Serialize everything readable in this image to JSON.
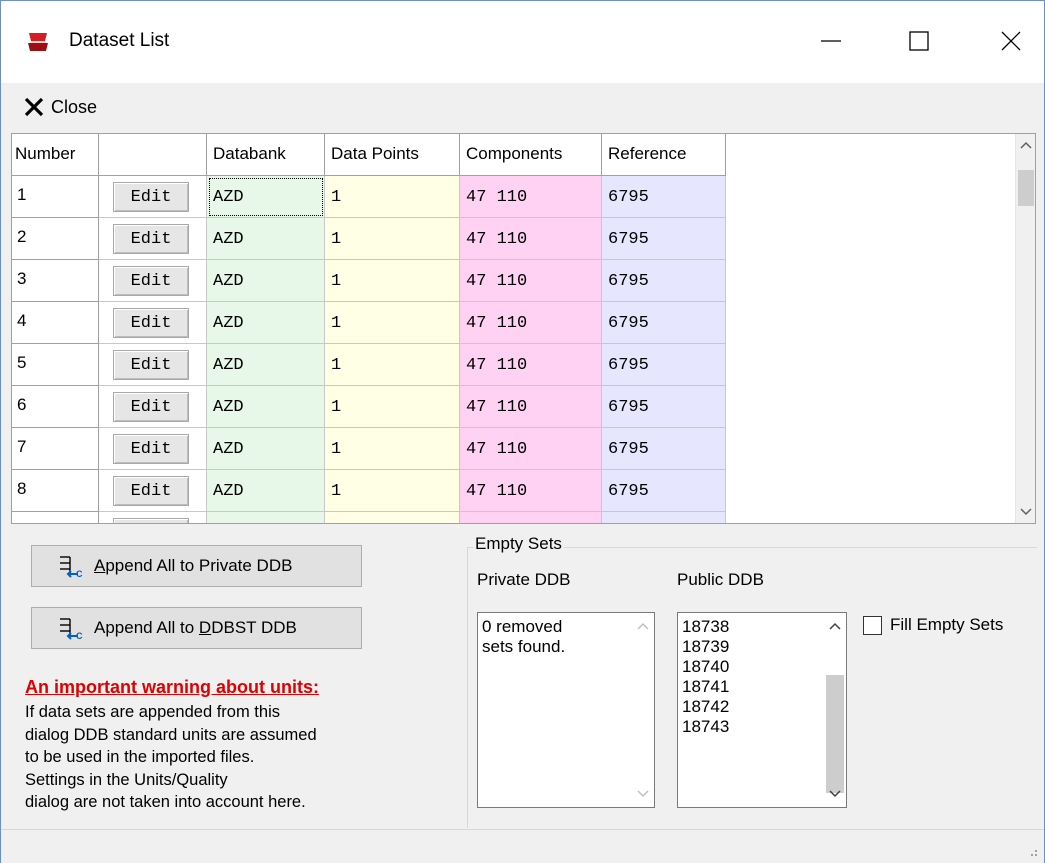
{
  "window": {
    "title": "Dataset List",
    "controls": {
      "minimize": "—",
      "maximize": "☐",
      "close": "✕"
    }
  },
  "toolbar": {
    "close_label": "Close"
  },
  "grid": {
    "columns": [
      "Number",
      "",
      "Databank",
      "Data Points",
      "Components",
      "Reference"
    ],
    "edit_label": "Edit",
    "rows": [
      {
        "number": "1",
        "databank": "AZD",
        "data_points": "1",
        "components": "47 110",
        "reference": "6795"
      },
      {
        "number": "2",
        "databank": "AZD",
        "data_points": "1",
        "components": "47 110",
        "reference": "6795"
      },
      {
        "number": "3",
        "databank": "AZD",
        "data_points": "1",
        "components": "47 110",
        "reference": "6795"
      },
      {
        "number": "4",
        "databank": "AZD",
        "data_points": "1",
        "components": "47 110",
        "reference": "6795"
      },
      {
        "number": "5",
        "databank": "AZD",
        "data_points": "1",
        "components": "47 110",
        "reference": "6795"
      },
      {
        "number": "6",
        "databank": "AZD",
        "data_points": "1",
        "components": "47 110",
        "reference": "6795"
      },
      {
        "number": "7",
        "databank": "AZD",
        "data_points": "1",
        "components": "47 110",
        "reference": "6795"
      },
      {
        "number": "8",
        "databank": "AZD",
        "data_points": "1",
        "components": "47 110",
        "reference": "6795"
      }
    ],
    "colors": {
      "databank": "#e8f8e8",
      "data_points": "#ffffe6",
      "components": "#ffd2f4",
      "reference": "#e6e6ff"
    }
  },
  "actions": {
    "append_private_prefix": "",
    "append_private_underlined": "A",
    "append_private_rest": "ppend All to Private DDB",
    "append_ddbst_prefix": "Append All to ",
    "append_ddbst_underlined": "D",
    "append_ddbst_rest": "DBST DDB"
  },
  "warning": {
    "title": "An important warning about units:",
    "lines": [
      "If data sets are appended from this",
      "dialog DDB standard units are assumed",
      "to be used in the imported files.",
      "Settings in the Units/Quality",
      "dialog are not taken into account here."
    ],
    "title_color": "#e00000"
  },
  "empty_sets": {
    "legend": "Empty Sets",
    "private_label": "Private DDB",
    "private_lines": [
      "0 removed",
      "sets found."
    ],
    "public_label": "Public DDB",
    "public_items": [
      "18738",
      "18739",
      "18740",
      "18741",
      "18742",
      "18743"
    ],
    "fill_label": "Fill Empty Sets"
  }
}
